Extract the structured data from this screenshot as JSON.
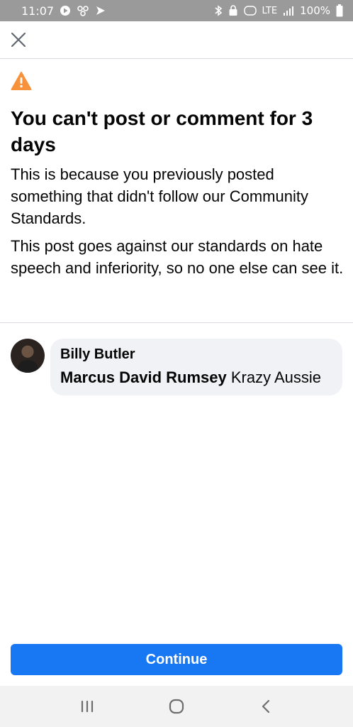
{
  "status_bar": {
    "time": "11:07",
    "network": "LTE",
    "battery_percent": "100%",
    "icons": [
      "media-icon",
      "pinwheel-icon",
      "send-icon",
      "bluetooth-icon",
      "lock-icon",
      "volte-icon",
      "signal-icon",
      "battery-icon"
    ]
  },
  "top_bar": {
    "close_icon": "close-icon"
  },
  "warning": {
    "icon": "warning-icon",
    "icon_color": "#f7923b",
    "headline": "You can't post or comment for 3 days",
    "paragraph_1": "This is because you previously posted something that didn't follow our Community Standards.",
    "paragraph_2": "This post goes against our standards on hate speech and inferiority, so no one else can see it."
  },
  "comment": {
    "author": "Billy Butler",
    "mention": "Marcus David Rumsey",
    "text": " Krazy Aussie"
  },
  "actions": {
    "continue_label": "Continue",
    "button_color": "#1877f2"
  },
  "nav_bar": {
    "buttons": [
      "recent-apps-icon",
      "home-icon",
      "back-icon"
    ]
  }
}
